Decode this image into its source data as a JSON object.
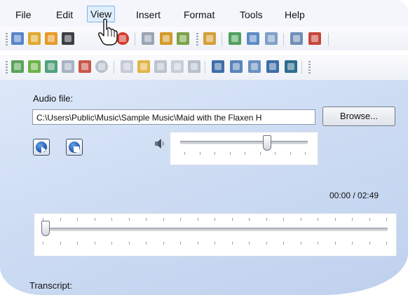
{
  "menu": [
    "File",
    "Edit",
    "View",
    "Insert",
    "Format",
    "Tools",
    "Help"
  ],
  "audio": {
    "label": "Audio file:",
    "path": "C:\\Users\\Public\\Music\\Sample Music\\Maid with the Flaxen H",
    "browse_label": "Browse..."
  },
  "playback": {
    "time": "00:00 / 02:49",
    "volume_fraction": 0.68,
    "position_fraction": 0.0
  },
  "transcript": {
    "label": "Transcript:"
  },
  "colors": {
    "panel_background": "#cddcf3",
    "menu_highlight": "#dfeefd",
    "media_button_blue": "#1b4fa6"
  },
  "icons": {
    "toolbar1": [
      "new-doc-icon",
      "open-folder-icon",
      "open-folder-alt-icon",
      "media-icon",
      "power-icon",
      "text-icon",
      "folder-home-icon",
      "folder-tree-icon",
      "open-project-icon",
      "document-green-icon",
      "document-blue-icon",
      "document-copy-icon",
      "note-icon",
      "delete-doc-icon"
    ],
    "toolbar2": [
      "add-doc-icon",
      "add-folder-icon",
      "add-page-icon",
      "add-item-icon",
      "import-icon",
      "disc-icon",
      "arrow-doc-icon",
      "folder-open-icon",
      "edit-doc-icon",
      "lightning-icon",
      "forward-icon",
      "doc-b-icon",
      "doc-right-icon",
      "doc-left-icon",
      "doc-split-icon",
      "doc-image-icon"
    ]
  }
}
